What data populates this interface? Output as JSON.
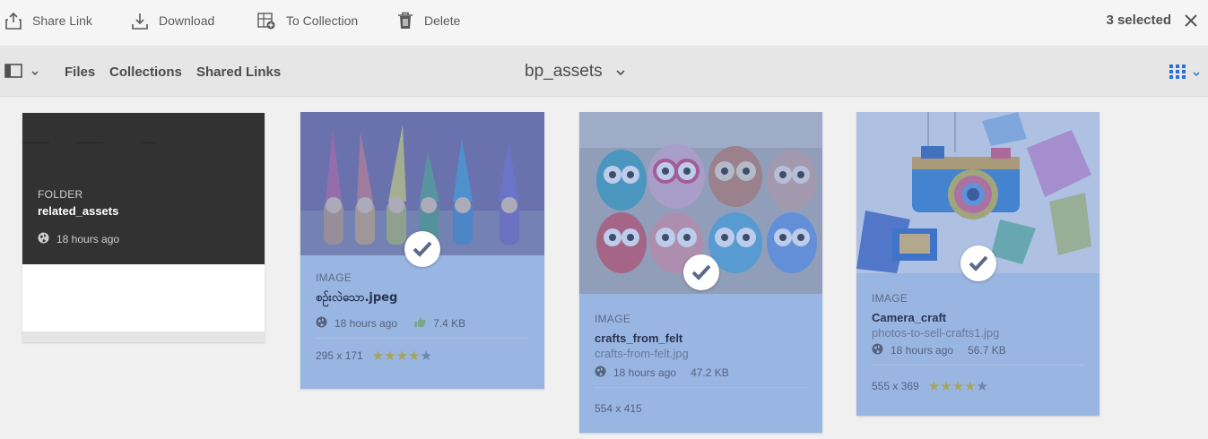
{
  "actionbar": {
    "share_label": "Share Link",
    "download_label": "Download",
    "collection_label": "To Collection",
    "delete_label": "Delete",
    "selected_text": "3 selected"
  },
  "navbar": {
    "files": "Files",
    "collections": "Collections",
    "shared_links": "Shared Links",
    "folder_name": "bp_assets"
  },
  "colors": {
    "selection": "#99b6e3",
    "folder_bg": "#323232",
    "accent": "#2d6fd6"
  },
  "cards": [
    {
      "type": "FOLDER",
      "title": "related_assets",
      "time": "18 hours ago",
      "icons": [
        "globe-icon"
      ]
    },
    {
      "type": "IMAGE",
      "title": "စဉ်းလဲသော.jpeg",
      "time": "18 hours ago",
      "size": "7.4 KB",
      "dimensions": "295 x 171",
      "rating": 4,
      "selected": true,
      "icons": [
        "globe-icon",
        "thumbs-up-icon"
      ]
    },
    {
      "type": "IMAGE",
      "title": "crafts_from_felt",
      "filename": "crafts-from-felt.jpg",
      "time": "18 hours ago",
      "size": "47.2 KB",
      "dimensions": "554 x 415",
      "selected": true,
      "icons": [
        "globe-icon"
      ]
    },
    {
      "type": "IMAGE",
      "title": "Camera_craft",
      "filename": "photos-to-sell-crafts1.jpg",
      "time": "18 hours ago",
      "size": "56.7 KB",
      "dimensions": "555 x 369",
      "rating": 4,
      "selected": true,
      "icons": [
        "globe-icon"
      ]
    }
  ]
}
